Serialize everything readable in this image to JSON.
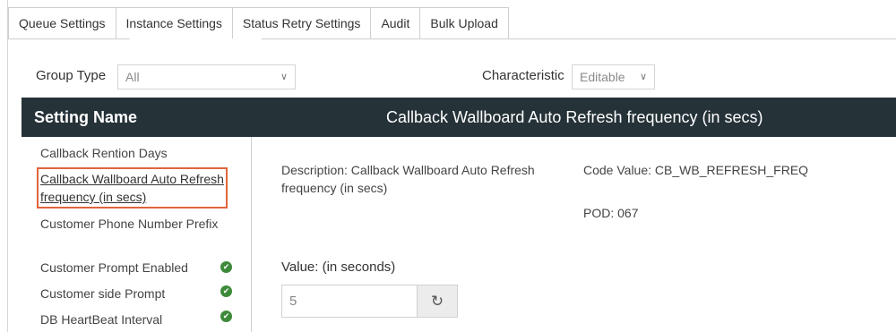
{
  "tabs": [
    {
      "label": "Queue Settings",
      "active": false
    },
    {
      "label": "Instance Settings",
      "active": true
    },
    {
      "label": "Status Retry Settings",
      "active": false
    },
    {
      "label": "Audit",
      "active": false
    },
    {
      "label": "Bulk Upload",
      "active": false
    }
  ],
  "filters": {
    "group_type_label": "Group Type",
    "group_type_value": "All",
    "characteristic_label": "Characteristic",
    "characteristic_value": "Editable"
  },
  "header": {
    "left_title": "Setting Name",
    "right_title": "Callback Wallboard Auto Refresh frequency (in secs)"
  },
  "settings_list": [
    {
      "label": "Callback Rention Days",
      "checked": false,
      "selected": false
    },
    {
      "label": "Callback Wallboard Auto Refresh frequency (in secs)",
      "checked": false,
      "selected": true
    },
    {
      "label": "Customer Phone Number Prefix",
      "checked": false,
      "selected": false
    },
    {
      "label": "Customer Prompt Enabled",
      "checked": true,
      "selected": false
    },
    {
      "label": "Customer side Prompt",
      "checked": true,
      "selected": false
    },
    {
      "label": "DB HeartBeat Interval",
      "checked": true,
      "selected": false
    }
  ],
  "detail": {
    "description": "Description: Callback Wallboard Auto Refresh frequency (in secs)",
    "code_value": "Code Value: CB_WB_REFRESH_FREQ",
    "pod": "POD: 067",
    "value_label": "Value: (in seconds)",
    "value": "5"
  },
  "icons": {
    "check": "check-circle-icon",
    "reset": "undo-icon",
    "dropdown": "chevron-down-icon"
  },
  "colors": {
    "header_bg": "#253238",
    "selected_border": "#e0653a",
    "check_green": "#3d8a3a"
  }
}
